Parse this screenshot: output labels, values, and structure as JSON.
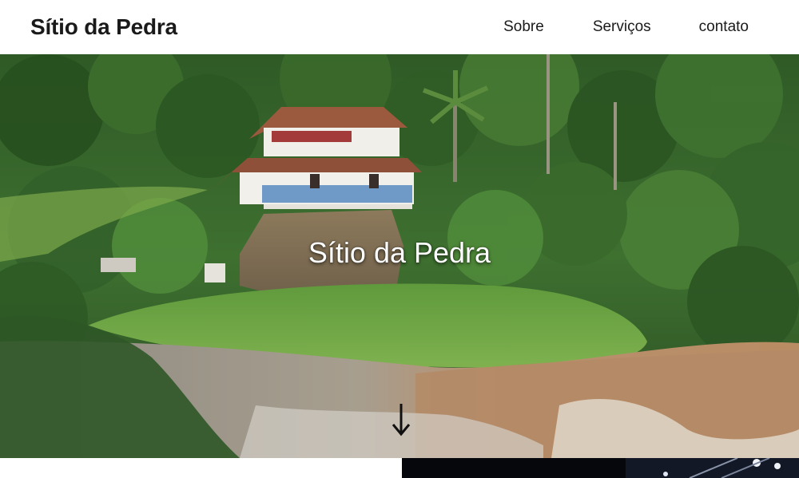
{
  "header": {
    "brand": "Sítio da Pedra",
    "nav": [
      {
        "label": "Sobre"
      },
      {
        "label": "Serviços"
      },
      {
        "label": "contato"
      }
    ]
  },
  "hero": {
    "title": "Sítio da Pedra",
    "scroll_icon": "arrow-down-icon"
  },
  "gallery": {
    "icons": [
      "photo-thumbnail"
    ]
  },
  "colors": {
    "header_bg": "#ffffff",
    "text": "#1a1a1a",
    "hero_title": "#ffffff"
  }
}
